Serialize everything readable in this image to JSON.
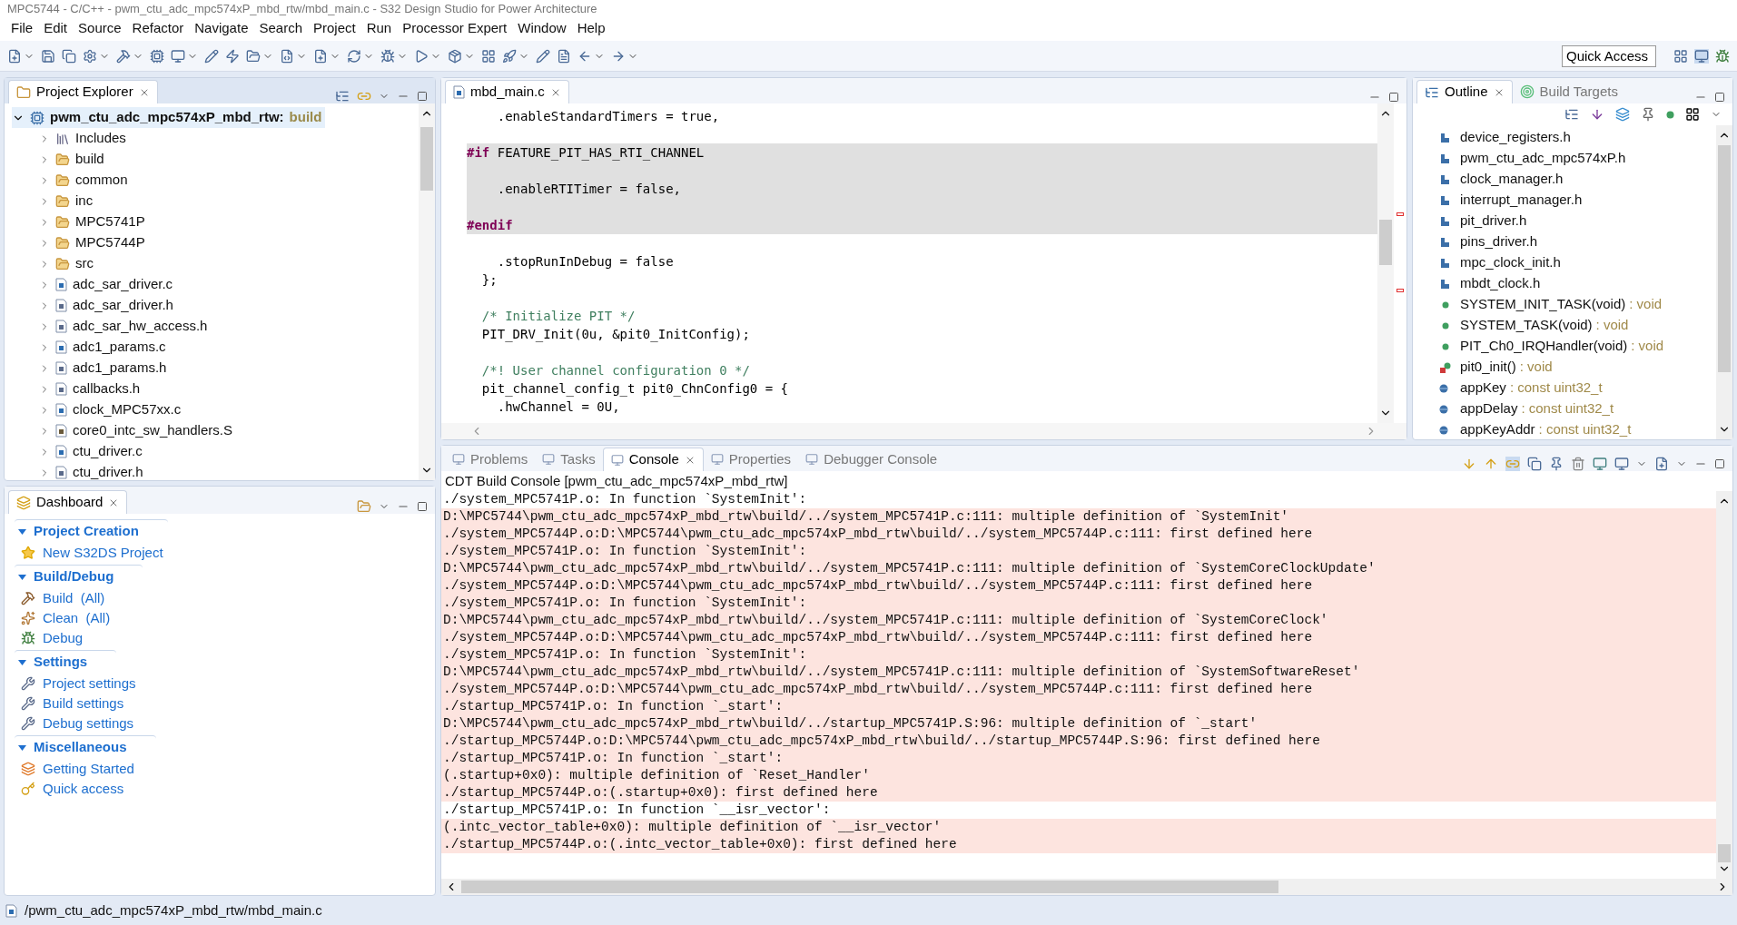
{
  "window": {
    "title": "MPC5744 - C/C++ - pwm_ctu_adc_mpc574xP_mbd_rtw/mbd_main.c - S32 Design Studio for Power Architecture"
  },
  "menu": [
    "File",
    "Edit",
    "Source",
    "Refactor",
    "Navigate",
    "Search",
    "Project",
    "Run",
    "Processor Expert",
    "Window",
    "Help"
  ],
  "quick_access": {
    "placeholder": "Quick Access"
  },
  "project_explorer": {
    "tab": {
      "label": "Project Explorer",
      "selected": true
    },
    "root": {
      "name": "pwm_ctu_adc_mpc574xP_mbd_rtw:",
      "config": "build",
      "expanded": true,
      "children": [
        {
          "label": "Includes",
          "kind": "includes",
          "expanded": false
        },
        {
          "label": "build",
          "kind": "folder",
          "expanded": false
        },
        {
          "label": "common",
          "kind": "folder",
          "expanded": false
        },
        {
          "label": "inc",
          "kind": "folder",
          "expanded": false
        },
        {
          "label": "MPC5741P",
          "kind": "folder",
          "expanded": false
        },
        {
          "label": "MPC5744P",
          "kind": "folder",
          "expanded": false
        },
        {
          "label": "src",
          "kind": "folder",
          "expanded": false
        },
        {
          "label": "adc_sar_driver.c",
          "kind": "c",
          "expanded": false
        },
        {
          "label": "adc_sar_driver.h",
          "kind": "h",
          "expanded": false
        },
        {
          "label": "adc_sar_hw_access.h",
          "kind": "h",
          "expanded": false
        },
        {
          "label": "adc1_params.c",
          "kind": "c",
          "expanded": false
        },
        {
          "label": "adc1_params.h",
          "kind": "h",
          "expanded": false
        },
        {
          "label": "callbacks.h",
          "kind": "h",
          "expanded": false
        },
        {
          "label": "clock_MPC57xx.c",
          "kind": "c",
          "expanded": false
        },
        {
          "label": "core0_intc_sw_handlers.S",
          "kind": "s",
          "expanded": false
        },
        {
          "label": "ctu_driver.c",
          "kind": "c",
          "expanded": false
        },
        {
          "label": "ctu_driver.h",
          "kind": "h",
          "expanded": false
        }
      ]
    }
  },
  "dashboard": {
    "tab": {
      "label": "Dashboard",
      "selected": true
    },
    "sections": [
      {
        "title": "Project Creation",
        "expanded": true,
        "items": [
          {
            "label": "New S32DS Project",
            "kind": "new"
          }
        ]
      },
      {
        "title": "Build/Debug",
        "expanded": true,
        "items": [
          {
            "label": "Build  (All)",
            "kind": "build"
          },
          {
            "label": "Clean  (All)",
            "kind": "clean"
          },
          {
            "label": "Debug",
            "kind": "debug"
          }
        ]
      },
      {
        "title": "Settings",
        "expanded": true,
        "items": [
          {
            "label": "Project settings",
            "kind": "settings"
          },
          {
            "label": "Build settings",
            "kind": "settings"
          },
          {
            "label": "Debug settings",
            "kind": "settings"
          }
        ]
      },
      {
        "title": "Miscellaneous",
        "expanded": true,
        "items": [
          {
            "label": "Getting Started",
            "kind": "start"
          },
          {
            "label": "Quick access",
            "kind": "key"
          }
        ]
      }
    ]
  },
  "editor": {
    "tab": {
      "label": "mbd_main.c",
      "selected": true
    },
    "lines": [
      {
        "inactive": false,
        "tokens": [
          {
            "text": "    .enableStandardTimers = true,",
            "kind": "plain"
          }
        ]
      },
      {
        "inactive": false
      },
      {
        "inactive": true,
        "tokens": [
          {
            "text": "#if",
            "kind": "directive"
          },
          {
            "text": " FEATURE_PIT_HAS_RTI_CHANNEL",
            "kind": "plain"
          }
        ]
      },
      {
        "inactive": true
      },
      {
        "inactive": true,
        "tokens": [
          {
            "text": "    .enableRTITimer = false,",
            "kind": "plain"
          }
        ]
      },
      {
        "inactive": true
      },
      {
        "inactive": true,
        "tokens": [
          {
            "text": "#endif",
            "kind": "directive"
          }
        ]
      },
      {
        "inactive": false
      },
      {
        "inactive": false,
        "tokens": [
          {
            "text": "    .stopRunInDebug = false",
            "kind": "plain"
          }
        ]
      },
      {
        "inactive": false,
        "tokens": [
          {
            "text": "  };",
            "kind": "plain"
          }
        ]
      },
      {
        "inactive": false
      },
      {
        "inactive": false,
        "tokens": [
          {
            "text": "  /* Initialize PIT */",
            "kind": "comment"
          }
        ]
      },
      {
        "inactive": false,
        "tokens": [
          {
            "text": "  PIT_DRV_Init(0u, &pit0_InitConfig);",
            "kind": "plain"
          }
        ]
      },
      {
        "inactive": false
      },
      {
        "inactive": false,
        "tokens": [
          {
            "text": "  /*! User channel configuration 0 */",
            "kind": "comment"
          }
        ]
      },
      {
        "inactive": false,
        "tokens": [
          {
            "text": "  pit_channel_config_t pit0_ChnConfig0 = {",
            "kind": "plain"
          }
        ]
      },
      {
        "inactive": false,
        "tokens": [
          {
            "text": "    .hwChannel = 0U,",
            "kind": "plain"
          }
        ]
      }
    ]
  },
  "outline": {
    "tabs": [
      {
        "label": "Outline",
        "selected": true
      },
      {
        "label": "Build Targets",
        "selected": false
      }
    ],
    "items": [
      {
        "name": "device_registers.h",
        "kind": "include"
      },
      {
        "name": "pwm_ctu_adc_mpc574xP.h",
        "kind": "include"
      },
      {
        "name": "clock_manager.h",
        "kind": "include"
      },
      {
        "name": "interrupt_manager.h",
        "kind": "include"
      },
      {
        "name": "pit_driver.h",
        "kind": "include"
      },
      {
        "name": "pins_driver.h",
        "kind": "include"
      },
      {
        "name": "mpc_clock_init.h",
        "kind": "include"
      },
      {
        "name": "mbdt_clock.h",
        "kind": "include"
      },
      {
        "name": "SYSTEM_INIT_TASK(void)",
        "type": ": void",
        "kind": "function"
      },
      {
        "name": "SYSTEM_TASK(void)",
        "type": ": void",
        "kind": "function"
      },
      {
        "name": "PIT_Ch0_IRQHandler(void)",
        "type": ": void",
        "kind": "function"
      },
      {
        "name": "pit0_init()",
        "type": ": void",
        "kind": "function_error"
      },
      {
        "name": "appKey",
        "type": ": const uint32_t",
        "kind": "constant"
      },
      {
        "name": "appDelay",
        "type": ": const uint32_t",
        "kind": "constant"
      },
      {
        "name": "appKeyAddr",
        "type": ": const uint32_t",
        "kind": "constant"
      }
    ]
  },
  "console": {
    "tabs": [
      {
        "label": "Problems",
        "selected": false
      },
      {
        "label": "Tasks",
        "selected": false
      },
      {
        "label": "Console",
        "selected": true
      },
      {
        "label": "Properties",
        "selected": false
      },
      {
        "label": "Debugger Console",
        "selected": false
      }
    ],
    "title": "CDT Build Console [pwm_ctu_adc_mpc574xP_mbd_rtw]",
    "lines": [
      {
        "text": "./system_MPC5741P.o: In function `SystemInit':",
        "error": false
      },
      {
        "text": "D:\\MPC5744\\pwm_ctu_adc_mpc574xP_mbd_rtw\\build/../system_MPC5741P.c:111: multiple definition of `SystemInit'",
        "error": true
      },
      {
        "text": "./system_MPC5744P.o:D:\\MPC5744\\pwm_ctu_adc_mpc574xP_mbd_rtw\\build/../system_MPC5744P.c:111: first defined here",
        "error": true
      },
      {
        "text": "./system_MPC5741P.o: In function `SystemInit':",
        "error": true
      },
      {
        "text": "D:\\MPC5744\\pwm_ctu_adc_mpc574xP_mbd_rtw\\build/../system_MPC5741P.c:111: multiple definition of `SystemCoreClockUpdate'",
        "error": true
      },
      {
        "text": "./system_MPC5744P.o:D:\\MPC5744\\pwm_ctu_adc_mpc574xP_mbd_rtw\\build/../system_MPC5744P.c:111: first defined here",
        "error": true
      },
      {
        "text": "./system_MPC5741P.o: In function `SystemInit':",
        "error": true
      },
      {
        "text": "D:\\MPC5744\\pwm_ctu_adc_mpc574xP_mbd_rtw\\build/../system_MPC5741P.c:111: multiple definition of `SystemCoreClock'",
        "error": true
      },
      {
        "text": "./system_MPC5744P.o:D:\\MPC5744\\pwm_ctu_adc_mpc574xP_mbd_rtw\\build/../system_MPC5744P.c:111: first defined here",
        "error": true
      },
      {
        "text": "./system_MPC5741P.o: In function `SystemInit':",
        "error": true
      },
      {
        "text": "D:\\MPC5744\\pwm_ctu_adc_mpc574xP_mbd_rtw\\build/../system_MPC5741P.c:111: multiple definition of `SystemSoftwareReset'",
        "error": true
      },
      {
        "text": "./system_MPC5744P.o:D:\\MPC5744\\pwm_ctu_adc_mpc574xP_mbd_rtw\\build/../system_MPC5744P.c:111: first defined here",
        "error": true
      },
      {
        "text": "./startup_MPC5741P.o: In function `_start':",
        "error": true
      },
      {
        "text": "D:\\MPC5744\\pwm_ctu_adc_mpc574xP_mbd_rtw\\build/../startup_MPC5741P.S:96: multiple definition of `_start'",
        "error": true
      },
      {
        "text": "./startup_MPC5744P.o:D:\\MPC5744\\pwm_ctu_adc_mpc574xP_mbd_rtw\\build/../startup_MPC5744P.S:96: first defined here",
        "error": true
      },
      {
        "text": "./startup_MPC5741P.o: In function `_start':",
        "error": true
      },
      {
        "text": "(.startup+0x0): multiple definition of `Reset_Handler'",
        "error": true
      },
      {
        "text": "./startup_MPC5744P.o:(.startup+0x0): first defined here",
        "error": true
      },
      {
        "text": "./startup_MPC5741P.o: In function `__isr_vector':",
        "error": false
      },
      {
        "text": "(.intc_vector_table+0x0): multiple definition of `__isr_vector'",
        "error": true
      },
      {
        "text": "./startup_MPC5744P.o:(.intc_vector_table+0x0): first defined here",
        "error": true
      }
    ]
  },
  "status_bar": {
    "path": "/pwm_ctu_adc_mpc574xP_mbd_rtw/mbd_main.c"
  }
}
